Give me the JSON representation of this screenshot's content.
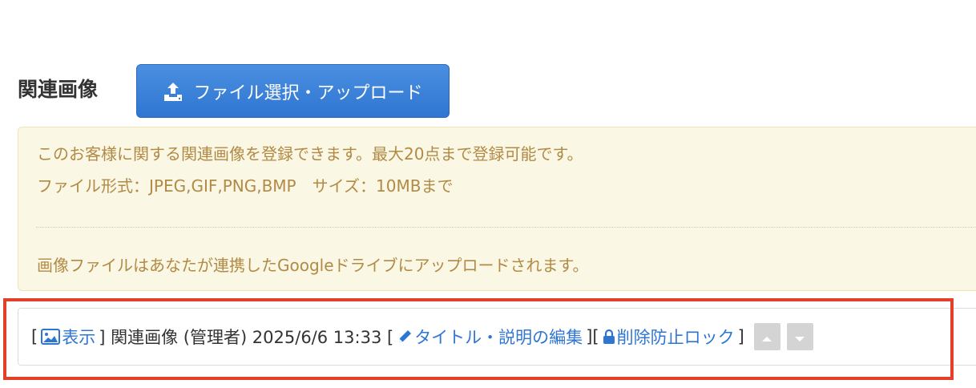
{
  "section": {
    "title": "関連画像",
    "upload_label": "ファイル選択・アップロード"
  },
  "notice": {
    "line1": "このお客様に関する関連画像を登録できます。最大20点まで登録可能です。",
    "line2": "ファイル形式：JPEG,GIF,PNG,BMP　サイズ：10MBまで",
    "line3": "画像ファイルはあなたが連携したGoogleドライブにアップロードされます。"
  },
  "item": {
    "bracket_open": "[",
    "view_label": "表示",
    "info": "] 関連画像 (管理者) 2025/6/6 13:33 [",
    "edit_label": "タイトル・説明の編集",
    "mid": "][",
    "lock_label": "削除防止ロック",
    "bracket_close": "]"
  },
  "colors": {
    "accent": "#2f76d2",
    "notice_text": "#b18a45",
    "notice_bg": "#fbf7e5",
    "highlight": "#e2402a"
  },
  "icons": [
    "upload-icon",
    "image-icon",
    "pencil-icon",
    "lock-icon",
    "arrow-up-icon",
    "arrow-down-icon"
  ]
}
